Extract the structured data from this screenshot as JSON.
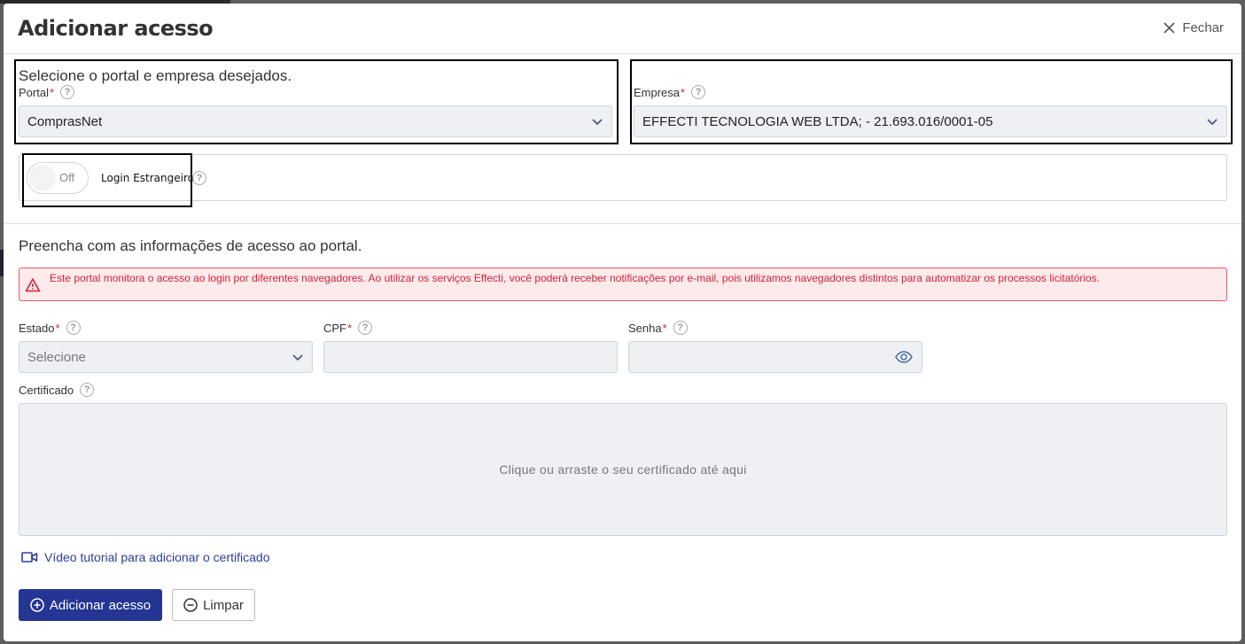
{
  "modal": {
    "title": "Adicionar acesso",
    "close_label": "Fechar"
  },
  "portal_section": {
    "title": "Selecione o portal e empresa desejados.",
    "portal_label": "Portal",
    "portal_value": "ComprasNet",
    "empresa_label": "Empresa",
    "empresa_value": "EFFECTI TECNOLOGIA WEB LTDA; - 21.693.016/0001-05",
    "required_mark": "*"
  },
  "toggle": {
    "state_label": "Off",
    "label": "Login Estrangeiro"
  },
  "access_section": {
    "title": "Preencha com as informações de acesso ao portal.",
    "alert_text": "Este portal monitora o acesso ao login por diferentes navegadores. Ao utilizar os serviços Effecti, você poderá receber notificações por e-mail, pois utilizamos navegadores distintos para automatizar os processos licitatórios.",
    "estado_label": "Estado",
    "estado_placeholder": "Selecione",
    "cpf_label": "CPF",
    "senha_label": "Senha",
    "certificado_label": "Certificado",
    "dropzone_text": "Clique ou arraste o seu certificado até aqui",
    "video_link": "Vídeo tutorial para adicionar o certificado"
  },
  "buttons": {
    "add": "Adicionar acesso",
    "clear": "Limpar"
  },
  "colors": {
    "primary": "#253593",
    "alert_text": "#d4213d",
    "alert_bg": "#fdeaea",
    "required": "#e02020",
    "link": "#2b3e9a"
  },
  "icons": {
    "help": "?"
  }
}
